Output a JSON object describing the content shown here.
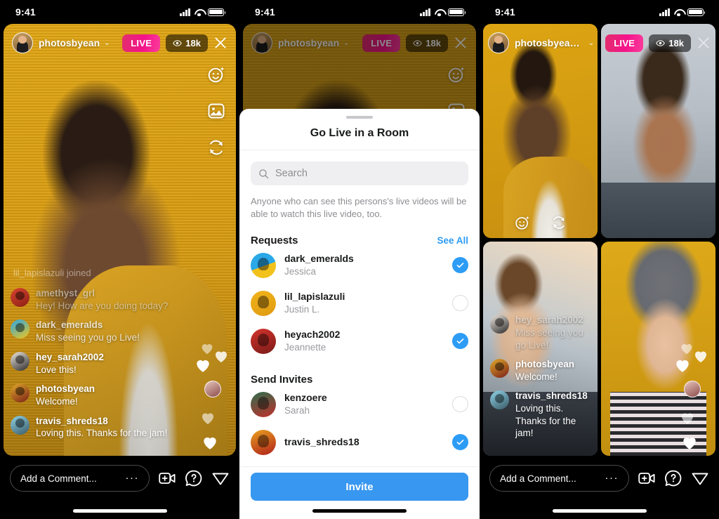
{
  "status_bar": {
    "time": "9:41",
    "icons": [
      "cellular-signal-icon",
      "wifi-icon",
      "battery-icon"
    ]
  },
  "brand": {
    "live_pink": "#f5138a",
    "accent_blue": "#3897f0",
    "link_blue": "#2d9cf5"
  },
  "live_header": {
    "handle": "photosbyean",
    "handle_group": "photosbyean, ame...",
    "chevron": "⌄",
    "live_label": "LIVE",
    "viewer_count": "18k",
    "close_label": "✕"
  },
  "tool_rail": [
    {
      "name": "effects-smiley-icon"
    },
    {
      "name": "media-gallery-icon"
    },
    {
      "name": "flip-camera-icon"
    }
  ],
  "panel1": {
    "joined_notice": "lil_lapislazuli joined",
    "comments": [
      {
        "username": "amethyst_grl",
        "text": "Hey! How are you doing today?",
        "style": "faded"
      },
      {
        "username": "dark_emeralds",
        "text": "Miss seeing you go Live!",
        "style": "faded2"
      },
      {
        "username": "hey_sarah2002",
        "text": "Love this!",
        "style": ""
      },
      {
        "username": "photosbyean",
        "text": "Welcome!",
        "style": ""
      },
      {
        "username": "travis_shreds18",
        "text": "Loving this. Thanks for the jam!",
        "style": ""
      }
    ]
  },
  "panel3": {
    "comments": [
      {
        "username": "hey_sarah2002",
        "text": "Miss seeing you go Live!",
        "style": "faded"
      },
      {
        "username": "photosbyean",
        "text": "Welcome!",
        "style": ""
      },
      {
        "username": "travis_shreds18",
        "text": "Loving this. Thanks for the jam!",
        "style": ""
      }
    ]
  },
  "compose": {
    "placeholder": "Add a Comment...",
    "more_dots": "···",
    "icons": [
      "add-video-icon",
      "question-help-icon",
      "share-direct-icon"
    ]
  },
  "sheet": {
    "title": "Go Live in a Room",
    "search_placeholder": "Search",
    "blurb": "Anyone who can see this persons's live videos will be able to watch this live video, too.",
    "requests_title": "Requests",
    "see_all_label": "See All",
    "requests": [
      {
        "username": "dark_emeralds",
        "realname": "Jessica",
        "selected": true,
        "av": "g1"
      },
      {
        "username": "lil_lapislazuli",
        "realname": "Justin L.",
        "selected": false,
        "av": "g2"
      },
      {
        "username": "heyach2002",
        "realname": "Jeannette",
        "selected": true,
        "av": "g3"
      }
    ],
    "invites_title": "Send Invites",
    "invites": [
      {
        "username": "kenzoere",
        "realname": "Sarah",
        "selected": false,
        "av": "g4"
      },
      {
        "username": "travis_shreds18",
        "realname": "",
        "selected": true,
        "av": "g5"
      }
    ],
    "invite_button": "Invite"
  }
}
